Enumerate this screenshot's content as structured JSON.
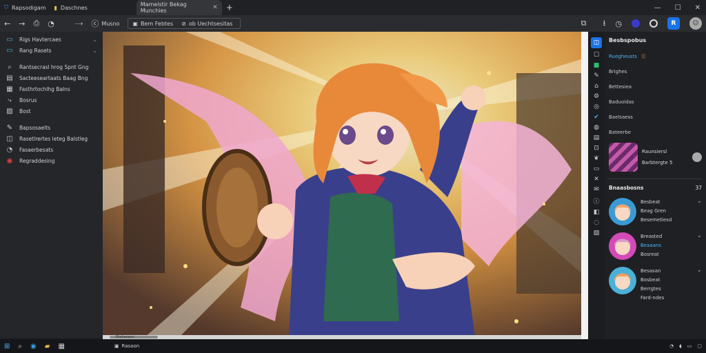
{
  "tabs": [
    {
      "label": "Rapsodigam",
      "active": false
    },
    {
      "label": "Daschnes",
      "active": false
    },
    {
      "label": "Mamelstir Bekag Munchies",
      "active": true
    }
  ],
  "toolbar": {
    "profile_label": "Musno",
    "address_label": "Bem Febtes",
    "site_label": "ob Uechtsesitas",
    "avatar_letter": "R"
  },
  "left_sidebar": [
    {
      "icon": "folder-icon",
      "label": "Rigs Havtercaes",
      "chev": "⌄"
    },
    {
      "icon": "folder-icon",
      "label": "Rang Rasets",
      "chev": "⌄"
    },
    {
      "icon": "search-icon",
      "label": "Rantsecrasl hrog Spnt Gng"
    },
    {
      "icon": "document-icon",
      "label": "Sacteeseartaats Baag Bng"
    },
    {
      "icon": "calendar-icon",
      "label": "Fasthrtochlhg Balns"
    },
    {
      "icon": "share-icon",
      "label": "Bosrus"
    },
    {
      "icon": "image-icon",
      "label": "Bost"
    },
    {
      "icon": "tool-icon",
      "label": "Bapsosaelts"
    },
    {
      "icon": "cart-icon",
      "label": "Rasetlrertes leteg Balstleg"
    },
    {
      "icon": "clock-icon",
      "label": "Fasaerbesats"
    },
    {
      "icon": "record-icon",
      "label": "Regraddesing"
    }
  ],
  "panel": {
    "title": "Besbspobus",
    "items": [
      {
        "label": "Ruegheusts",
        "badge": "Ⓒ"
      },
      {
        "label": "Brighes"
      },
      {
        "label": "Bettesiea"
      },
      {
        "label": "Baduoidas"
      },
      {
        "label": "Baelsaess"
      },
      {
        "label": "Bateerbe"
      }
    ],
    "card_title": "Raunsiersl",
    "card_sub": "Barbtergte 5",
    "section_title": "Bnaasbosns",
    "section_count": "37",
    "avatars": [
      {
        "lines": [
          "Besbeat",
          "Beag Gren",
          "Besemetlesd"
        ]
      },
      {
        "lines": [
          "Breasted",
          "Beaaans",
          "Bosreat"
        ]
      },
      {
        "lines": [
          "Besasan",
          "Bosbeat",
          "Berrgtes",
          "Fard-ndes"
        ]
      }
    ]
  },
  "statusbar": {
    "label": "Rtabasaon"
  },
  "taskbar": {
    "app_label": "Rasaon"
  },
  "colors": {
    "accent": "#1a73e8",
    "bg": "#1f2023",
    "panel": "#25262a"
  }
}
